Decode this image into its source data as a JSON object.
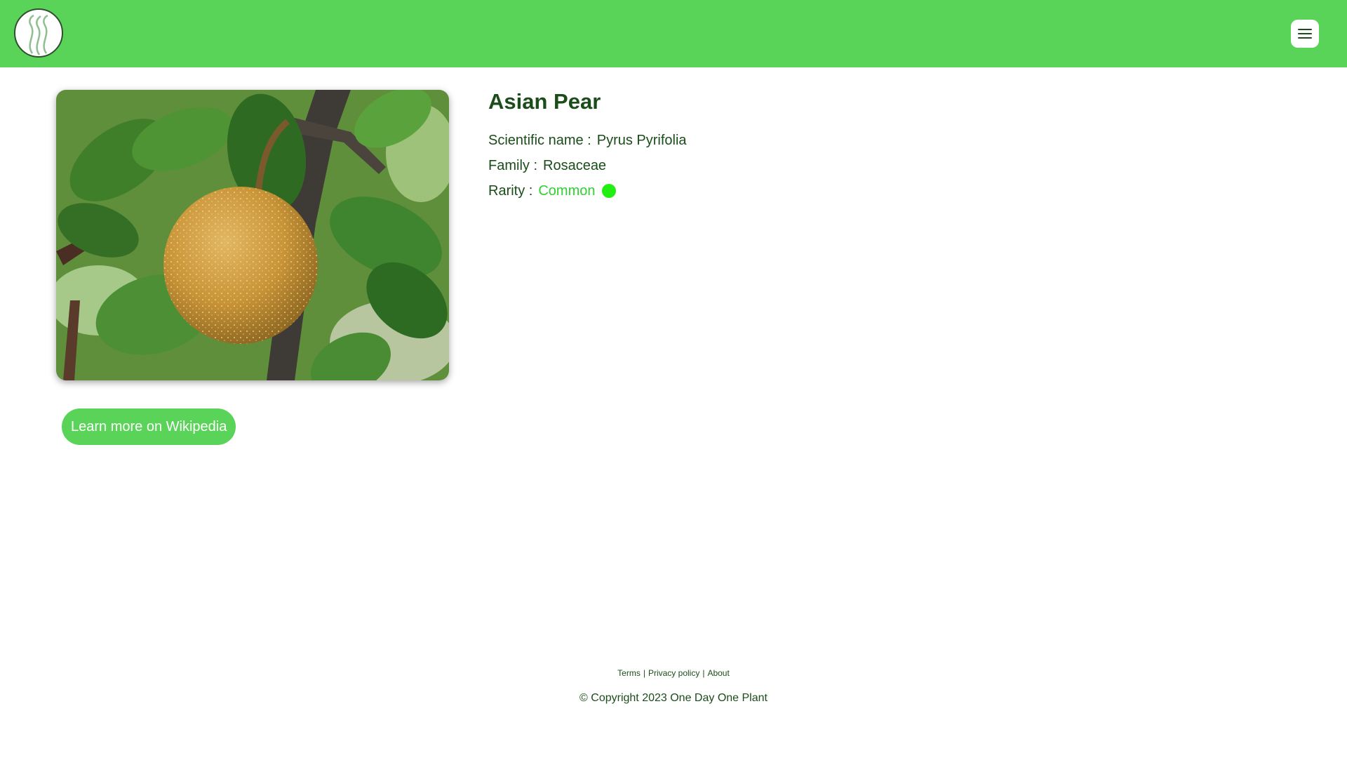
{
  "header": {
    "logo_icon": "leaf-swirl-logo",
    "menu_icon": "hamburger-menu-icon",
    "background_color": "#59d459"
  },
  "plant": {
    "name": "Asian Pear",
    "scientific_label": "Scientific name :",
    "scientific_name": "Pyrus Pyrifolia",
    "family_label": "Family :",
    "family": "Rosaceae",
    "rarity_label": "Rarity :",
    "rarity": "Common",
    "rarity_color": "#22ee11",
    "image_subject": "asian-pear-fruit-photo"
  },
  "actions": {
    "wikipedia_button": "Learn more on Wikipedia"
  },
  "footer": {
    "links": [
      "Terms",
      "Privacy policy",
      "About"
    ],
    "separator": "|",
    "copyright": "© Copyright 2023 One Day One Plant"
  }
}
